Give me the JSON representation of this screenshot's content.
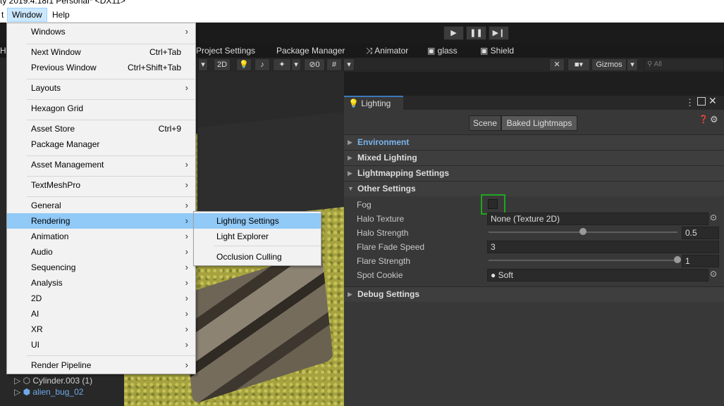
{
  "window_title": "ty 2019.4.18f1 Personal* <DX11>",
  "menubar": {
    "partial_left": "t",
    "window": "Window",
    "help": "Help"
  },
  "toolbar": {
    "play": "▶",
    "pause": "❚❚",
    "step": "▶❙"
  },
  "tabs": [
    "Hi",
    "Project Settings",
    "Package Manager",
    "Animator",
    "glass",
    "Shield"
  ],
  "scene_toolbar": {
    "mode_2d": "2D",
    "hidden_count": "0",
    "gizmos": "Gizmos",
    "search_placeholder": "All"
  },
  "hierarchy": [
    {
      "label": "Cylinder.003 (1)",
      "color": "#cfcfcf"
    },
    {
      "label": "alien_bug_02",
      "color": "#6fa8e6"
    }
  ],
  "window_menu": [
    {
      "label": "Windows",
      "submenu": true
    },
    {
      "label": "Next Window",
      "shortcut": "Ctrl+Tab"
    },
    {
      "label": "Previous Window",
      "shortcut": "Ctrl+Shift+Tab"
    },
    {
      "label": "Layouts",
      "submenu": true
    },
    {
      "label": "Hexagon Grid"
    },
    {
      "label": "Asset Store",
      "shortcut": "Ctrl+9"
    },
    {
      "label": "Package Manager"
    },
    {
      "label": "Asset Management",
      "submenu": true
    },
    {
      "label": "TextMeshPro",
      "submenu": true
    },
    {
      "label": "General",
      "submenu": true
    },
    {
      "label": "Rendering",
      "submenu": true,
      "highlighted": true
    },
    {
      "label": "Animation",
      "submenu": true
    },
    {
      "label": "Audio",
      "submenu": true
    },
    {
      "label": "Sequencing",
      "submenu": true
    },
    {
      "label": "Analysis",
      "submenu": true
    },
    {
      "label": "2D",
      "submenu": true
    },
    {
      "label": "AI",
      "submenu": true
    },
    {
      "label": "XR",
      "submenu": true
    },
    {
      "label": "UI",
      "submenu": true
    },
    {
      "label": "Render Pipeline",
      "submenu": true
    }
  ],
  "rendering_submenu": [
    {
      "label": "Lighting Settings",
      "highlighted": true
    },
    {
      "label": "Light Explorer"
    },
    {
      "label": "Occlusion Culling"
    }
  ],
  "lighting": {
    "tab_title": "Lighting",
    "segment_scene": "Scene",
    "segment_baked": "Baked Lightmaps",
    "sections": {
      "environment": "Environment",
      "mixed": "Mixed Lighting",
      "lightmapping": "Lightmapping Settings",
      "other": "Other Settings",
      "debug": "Debug Settings"
    },
    "props": {
      "fog": "Fog",
      "halo_texture": "Halo Texture",
      "halo_texture_value": "None (Texture 2D)",
      "halo_strength": "Halo Strength",
      "halo_strength_value": "0.5",
      "halo_strength_fraction": 0.5,
      "flare_fade_speed": "Flare Fade Speed",
      "flare_fade_speed_value": "3",
      "flare_strength": "Flare Strength",
      "flare_strength_value": "1",
      "flare_strength_fraction": 1.0,
      "spot_cookie": "Spot Cookie",
      "spot_cookie_value": "Soft"
    },
    "fog_enabled": false,
    "accent_color": "#3a79bb",
    "highlight_box_color": "#1fa61f"
  }
}
